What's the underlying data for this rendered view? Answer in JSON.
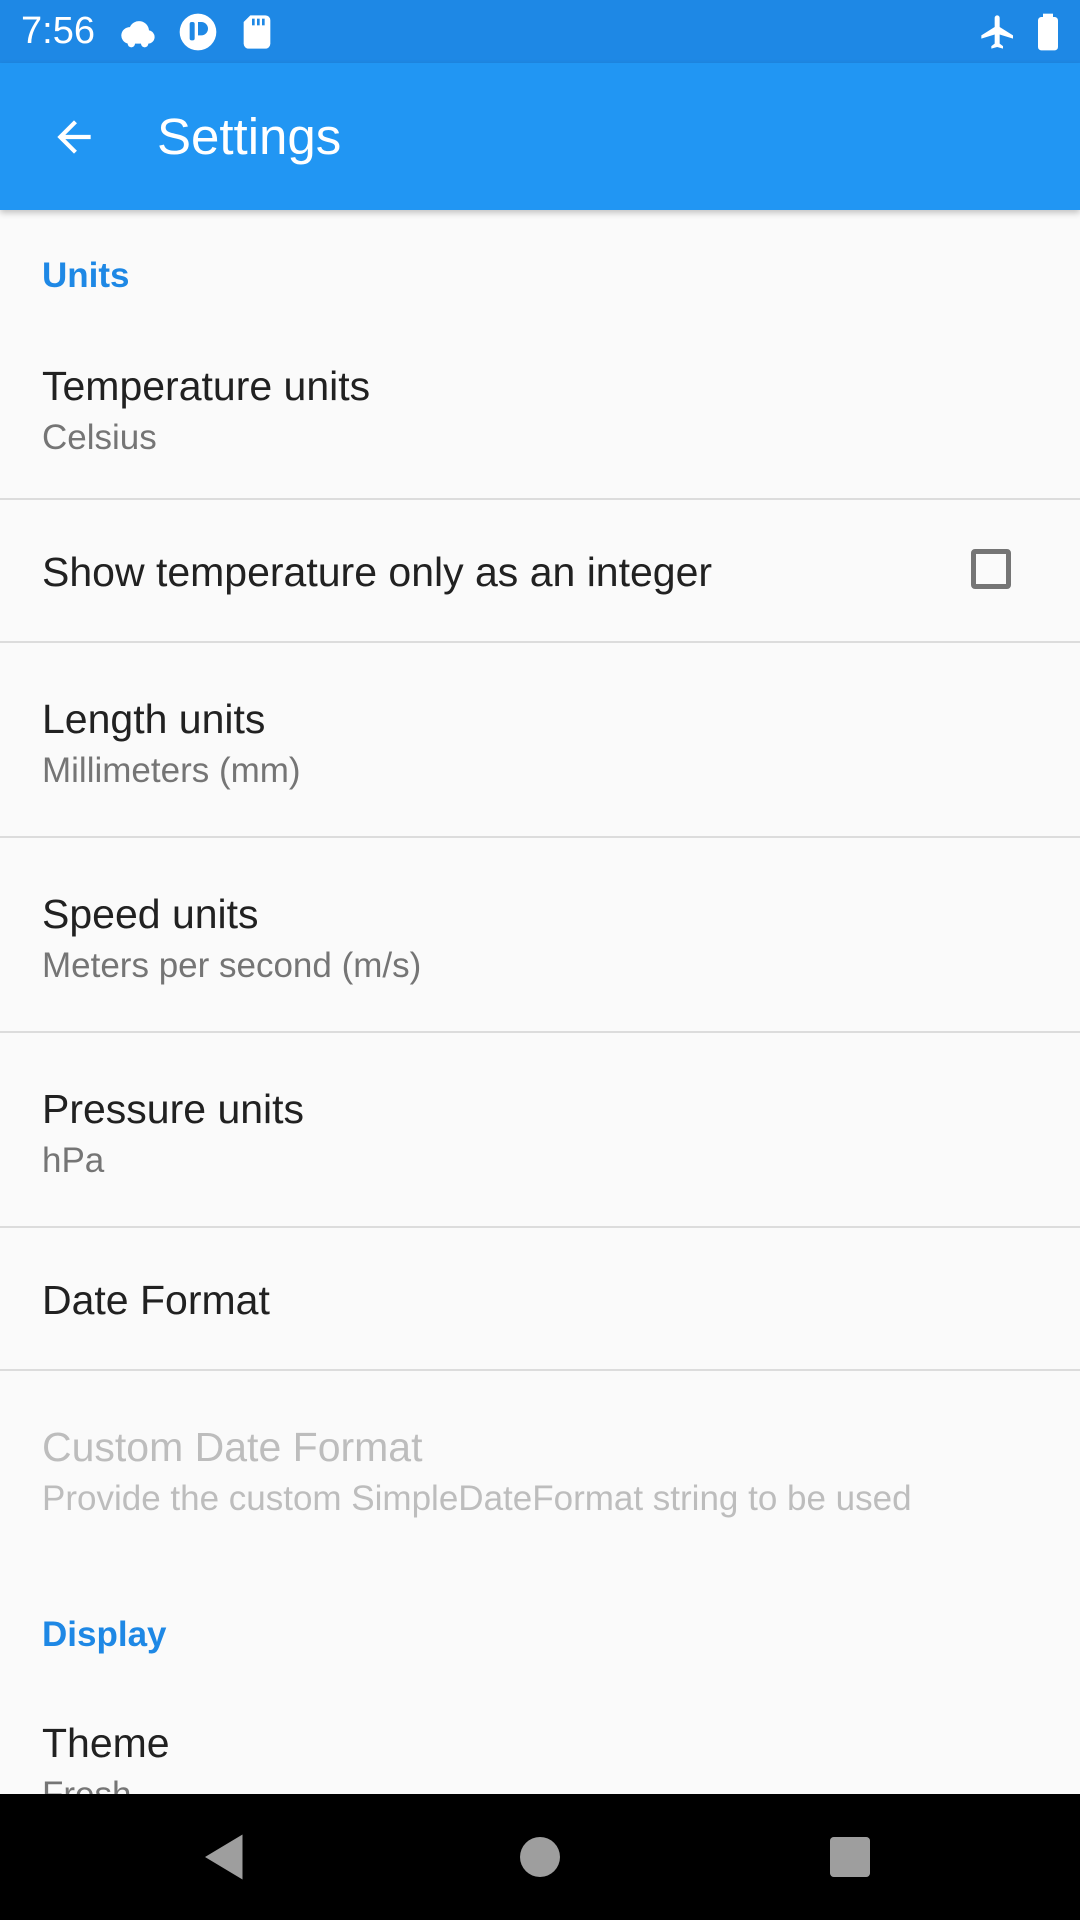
{
  "status_bar": {
    "time": "7:56",
    "icons": [
      "cloud-icon",
      "sync-icon",
      "sd-card-icon",
      "airplane-icon",
      "battery-icon"
    ]
  },
  "app_bar": {
    "title": "Settings",
    "back_icon": "back-arrow-icon"
  },
  "colors": {
    "status_bar": "#1e88e5",
    "app_bar": "#2196f3",
    "accent": "#1e88e5",
    "background": "#fafafa"
  },
  "sections": {
    "units": {
      "label": "Units",
      "temperature": {
        "title": "Temperature units",
        "summary": "Celsius"
      },
      "integer": {
        "title": "Show temperature only as an integer",
        "checked": false
      },
      "length": {
        "title": "Length units",
        "summary": "Millimeters (mm)"
      },
      "speed": {
        "title": "Speed units",
        "summary": "Meters per second (m/s)"
      },
      "pressure": {
        "title": "Pressure units",
        "summary": "hPa"
      },
      "date_format": {
        "title": "Date Format"
      },
      "custom_date": {
        "title": "Custom Date Format",
        "summary": "Provide the custom SimpleDateFormat string to be used"
      }
    },
    "display": {
      "label": "Display",
      "theme": {
        "title": "Theme",
        "summary": "Fresh"
      }
    }
  },
  "nav_bar": {
    "buttons": [
      "back-triangle-icon",
      "home-circle-icon",
      "recents-square-icon"
    ]
  }
}
